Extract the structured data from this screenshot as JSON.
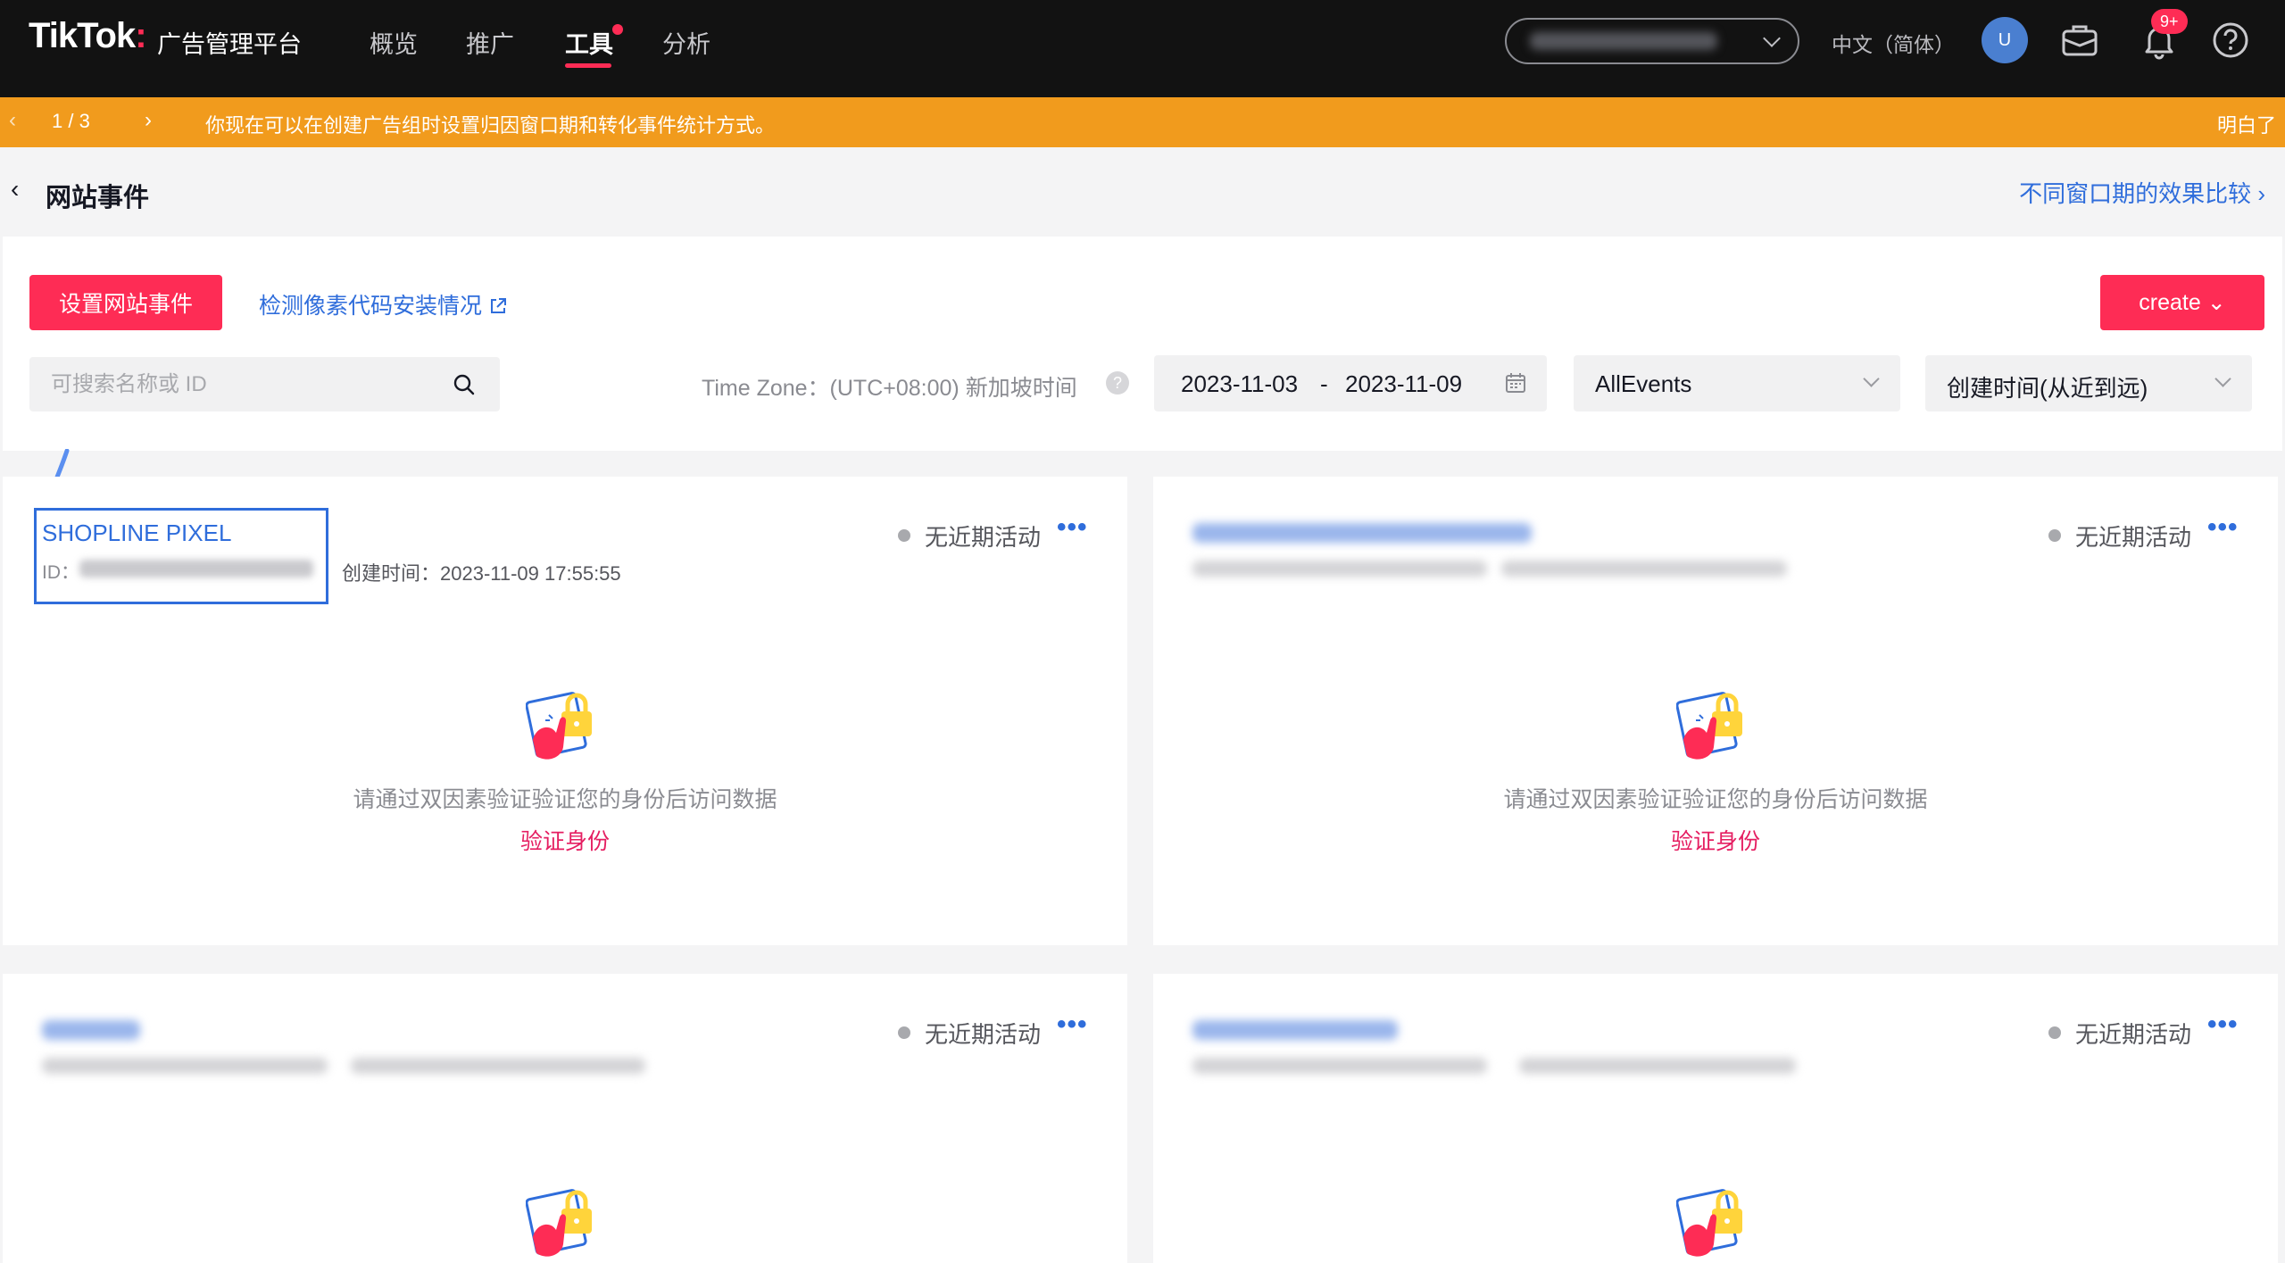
{
  "header": {
    "logo": "TikTok",
    "logo_colon": ":",
    "platform_name": "广告管理平台",
    "nav": [
      "概览",
      "推广",
      "工具",
      "分析"
    ],
    "language": "中文（简体）",
    "avatar_letter": "U",
    "notification_badge": "9+"
  },
  "notice": {
    "pager": "1  /  3",
    "message": "你现在可以在创建广告组时设置归因窗口期和转化事件统计方式。",
    "dismiss": "明白了"
  },
  "page": {
    "title": "网站事件",
    "compare_link": "不同窗口期的效果比较"
  },
  "toolbar": {
    "setup_button": "设置网站事件",
    "check_link": "检测像素代码安装情况",
    "create_button": "create",
    "search_placeholder": "可搜索名称或 ID",
    "timezone": "Time Zone：(UTC+08:00) 新加坡时间",
    "help": "?",
    "date_start": "2023-11-03",
    "date_sep": "-",
    "date_end": "2023-11-09",
    "event_filter": "AllEvents",
    "sort": "创建时间(从近到远)"
  },
  "cards": [
    {
      "name": "SHOPLINE PIXEL",
      "id_label": "ID：",
      "created": "创建时间：2023-11-09 17:55:55",
      "status": "无近期活动",
      "more": "•••",
      "tip": "请通过双因素验证验证您的身份后访问数据",
      "verify": "验证身份"
    },
    {
      "status": "无近期活动",
      "more": "•••",
      "tip": "请通过双因素验证验证您的身份后访问数据",
      "verify": "验证身份"
    },
    {
      "status": "无近期活动",
      "more": "•••"
    },
    {
      "status": "无近期活动",
      "more": "•••"
    }
  ],
  "colors": {
    "brand": "#fe2c55",
    "link": "#2f6ddb",
    "notice": "#f19b1d",
    "topbar": "#121212"
  }
}
